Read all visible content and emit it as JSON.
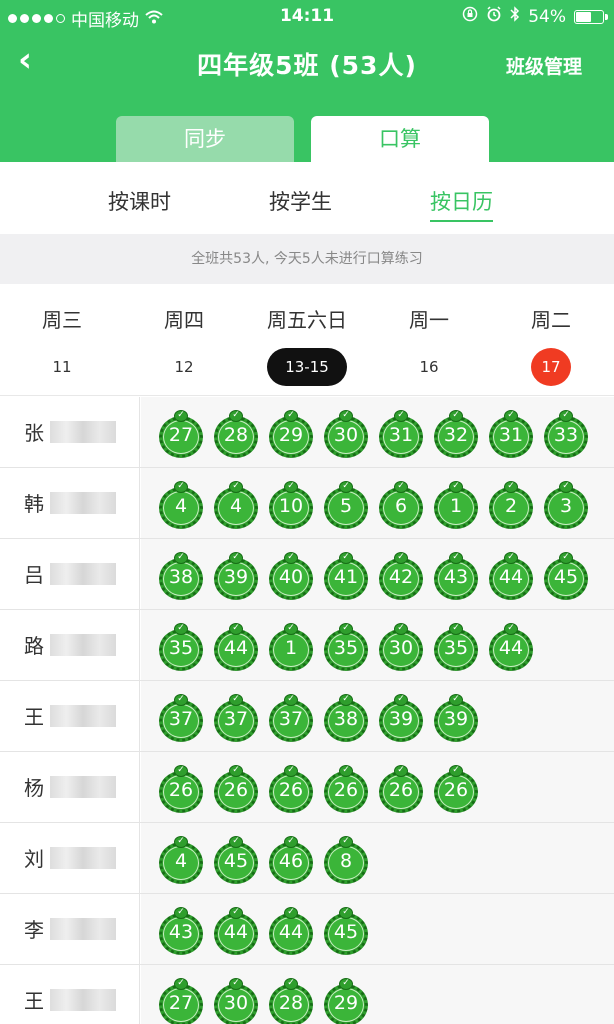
{
  "status": {
    "carrier": "中国移动",
    "time": "14:11",
    "battery_text": "54%",
    "battery_level": 0.54
  },
  "navbar": {
    "back_icon": "‹",
    "title": "四年级5班 (53人)",
    "manage_label": "班级管理"
  },
  "tabs": {
    "sync_label": "同步",
    "oral_label": "口算"
  },
  "subtabs": {
    "by_lesson": "按课时",
    "by_student": "按学生",
    "by_calendar": "按日历"
  },
  "notice": "全班共53人, 今天5人未进行口算练习",
  "calendar": [
    {
      "weekday": "周三",
      "date": "11"
    },
    {
      "weekday": "周四",
      "date": "12"
    },
    {
      "weekday": "周五六日",
      "date": "13-15"
    },
    {
      "weekday": "周一",
      "date": "16"
    },
    {
      "weekday": "周二",
      "date": "17"
    }
  ],
  "students": [
    {
      "surname": "张",
      "scores": [
        "27",
        "28",
        "29",
        "30",
        "31",
        "32",
        "31",
        "33"
      ]
    },
    {
      "surname": "韩",
      "scores": [
        "4",
        "4",
        "10",
        "5",
        "6",
        "1",
        "2",
        "3"
      ]
    },
    {
      "surname": "吕",
      "scores": [
        "38",
        "39",
        "40",
        "41",
        "42",
        "43",
        "44",
        "45"
      ]
    },
    {
      "surname": "路",
      "scores": [
        "35",
        "44",
        "1",
        "35",
        "30",
        "35",
        "44"
      ]
    },
    {
      "surname": "王",
      "scores": [
        "37",
        "37",
        "37",
        "38",
        "39",
        "39"
      ]
    },
    {
      "surname": "杨",
      "scores": [
        "26",
        "26",
        "26",
        "26",
        "26",
        "26"
      ]
    },
    {
      "surname": "刘",
      "scores": [
        "4",
        "45",
        "46",
        "8"
      ]
    },
    {
      "surname": "李",
      "scores": [
        "43",
        "44",
        "44",
        "45"
      ]
    },
    {
      "surname": "王",
      "scores": [
        "27",
        "30",
        "28",
        "29"
      ]
    }
  ],
  "colors": {
    "brand_green": "#39c463",
    "badge_green": "#2f9e2d",
    "today_red": "#f03b22"
  }
}
